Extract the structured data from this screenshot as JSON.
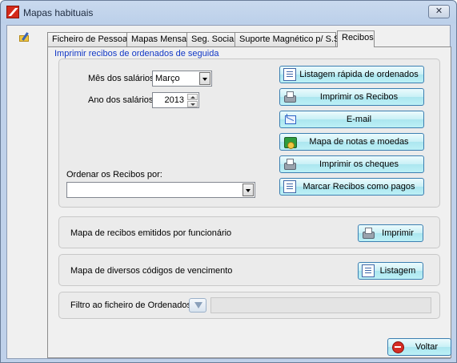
{
  "window": {
    "title": "Mapas habituais",
    "close_label": "✕"
  },
  "tabs": [
    {
      "label": "Ficheiro de Pessoal"
    },
    {
      "label": "Mapas Mensais"
    },
    {
      "label": "Seg. Social"
    },
    {
      "label": "Suporte Magnético p/ S.S."
    },
    {
      "label": "Recibos",
      "active": true
    }
  ],
  "recibos": {
    "heading": "Imprimir recibos de ordenados de seguida",
    "mes_label": "Mês dos salários",
    "mes_value": "Março",
    "ano_label": "Ano dos salários",
    "ano_value": "2013",
    "ordenar_label": "Ordenar os Recibos por:",
    "ordenar_value": "",
    "buttons": {
      "listagem_rapida": "Listagem rápida de ordenados",
      "imprimir_recibos": "Imprimir os Recibos",
      "email": "E-mail",
      "mapa_notas": "Mapa de notas e moedas",
      "imprimir_cheques": "Imprimir os cheques",
      "marcar_pagos": "Marcar Recibos como pagos"
    }
  },
  "mapa_recibos": {
    "label": "Mapa de recibos emitidos por funcionário",
    "button": "Imprimir"
  },
  "mapa_codigos": {
    "label": "Mapa de diversos códigos de vencimento",
    "button": "Listagem"
  },
  "filtro": {
    "label": "Filtro ao ficheiro de Ordenados",
    "value": ""
  },
  "footer": {
    "voltar_label": "Voltar"
  },
  "icons": {
    "listagem_rapida": "document-icon",
    "imprimir_recibos": "printer-icon",
    "email": "email-icon",
    "mapa_notas": "money-icon",
    "imprimir_cheques": "printer-icon",
    "marcar_pagos": "document-icon",
    "voltar": "stop-icon"
  }
}
